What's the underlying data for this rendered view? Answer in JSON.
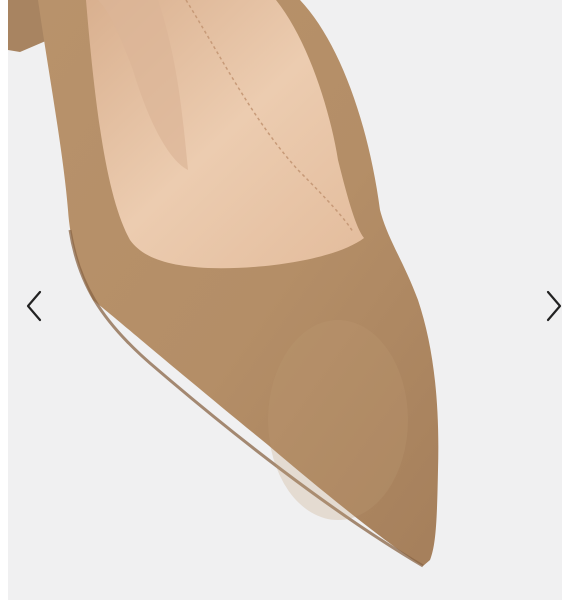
{
  "gallery": {
    "image": {
      "alt": "Tan suede pointed-toe pump",
      "colors": {
        "background": "#f0f0f1",
        "suede": "#b48e67",
        "suede_shadow": "#9c7552",
        "lining": "#e7c6aa",
        "lining_shadow": "#cfa587",
        "sole_edge": "#8a6646"
      }
    },
    "prev_button": {
      "icon": "chevron-left-icon",
      "color": "#222222"
    },
    "next_button": {
      "icon": "chevron-right-icon",
      "color": "#222222"
    }
  }
}
